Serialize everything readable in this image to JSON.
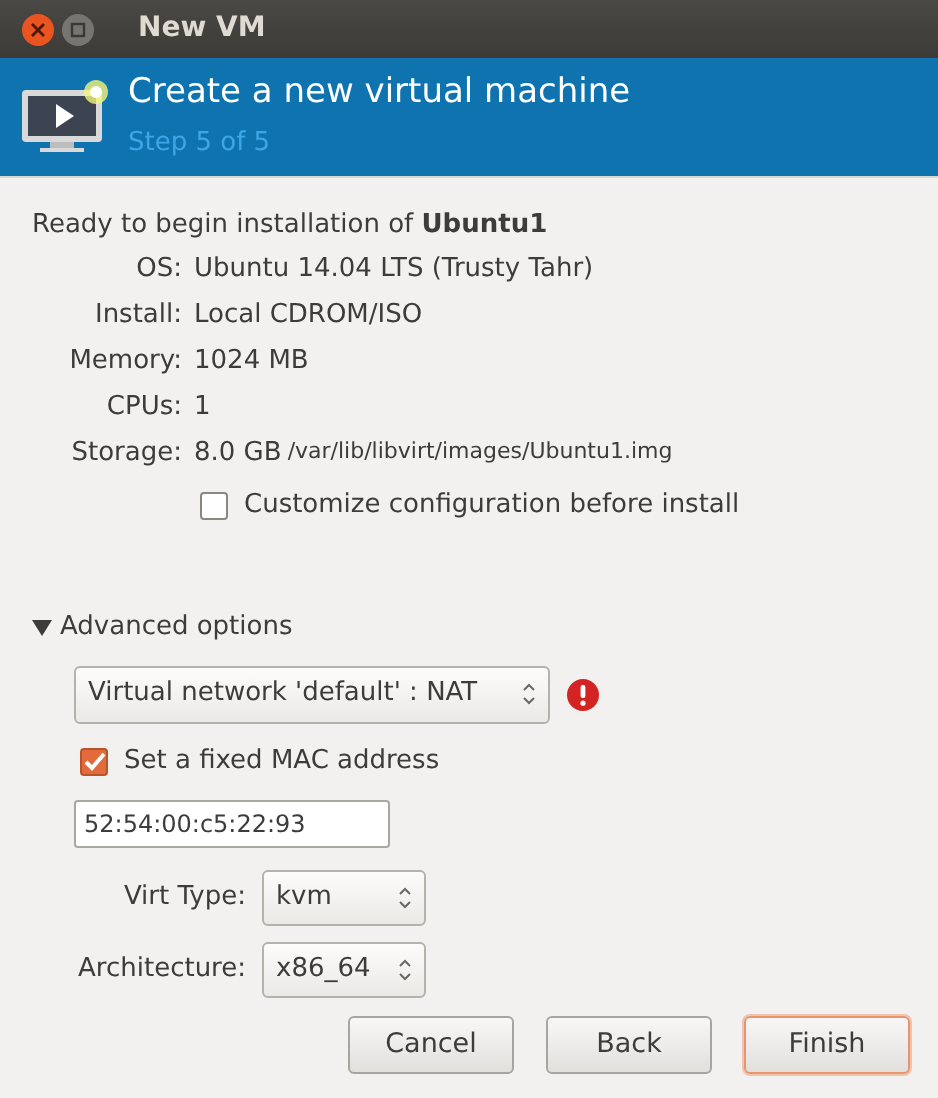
{
  "window": {
    "title": "New VM"
  },
  "header": {
    "title": "Create a new virtual machine",
    "subtitle": "Step 5 of 5"
  },
  "summary": {
    "intro": "Ready to begin installation of **Ubuntu1**",
    "rows": [
      {
        "label": "OS:",
        "value": "Ubuntu 14.04 LTS (Trusty Tahr)"
      },
      {
        "label": "Install:",
        "value": "Local CDROM/ISO"
      },
      {
        "label": "Memory:",
        "value": "1024 MB"
      },
      {
        "label": "CPUs:",
        "value": "1"
      },
      {
        "label": "Storage:",
        "value": "8.0 GB",
        "detail": "/var/lib/libvirt/images/Ubuntu1.img"
      }
    ]
  },
  "customize": {
    "label": "Customize configuration before install",
    "checked": false
  },
  "advanced": {
    "label": "Advanced options",
    "expanded": true,
    "network": {
      "value": "Virtual network 'default' : NAT",
      "error": true
    },
    "fixed_mac": {
      "label": "Set a fixed MAC address",
      "checked": true
    },
    "mac_address": {
      "value": "52:54:00:c5:22:93"
    },
    "selects": [
      {
        "label": "Virt Type:",
        "value": "kvm"
      },
      {
        "label": "Architecture:",
        "value": "x86_64"
      }
    ]
  },
  "buttons": [
    {
      "label": "Cancel",
      "default": false
    },
    {
      "label": "Back",
      "default": false
    },
    {
      "label": "Finish",
      "default": true
    }
  ]
}
